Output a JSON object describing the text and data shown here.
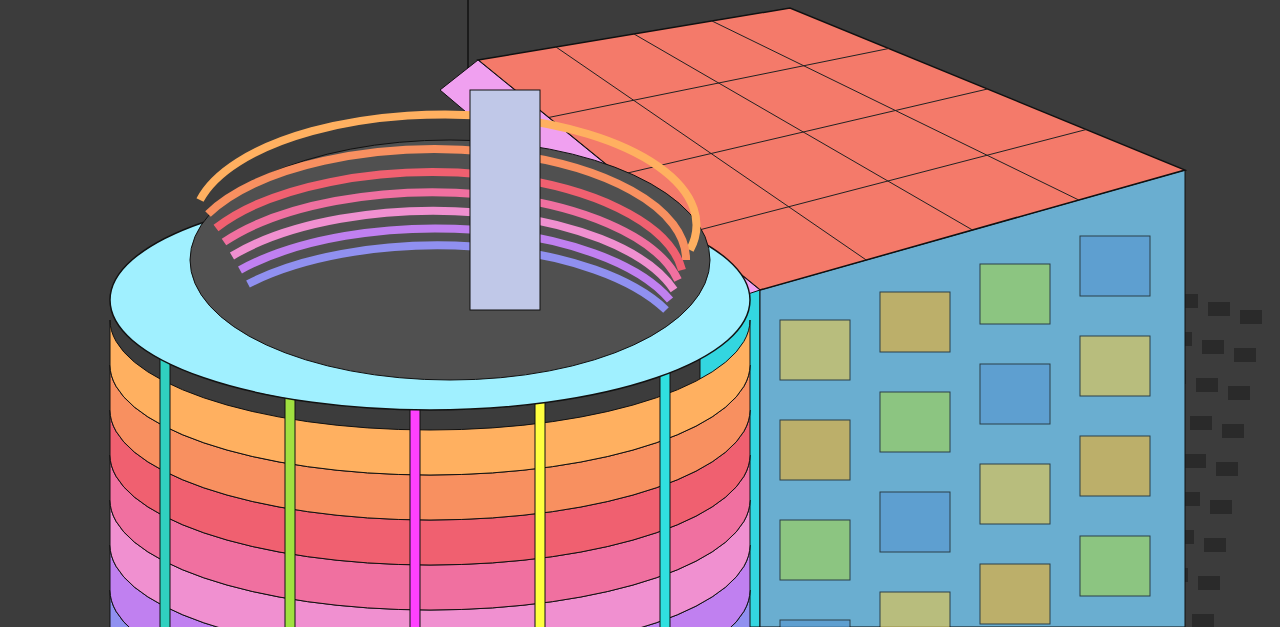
{
  "viewport": {
    "kind": "model-render"
  }
}
